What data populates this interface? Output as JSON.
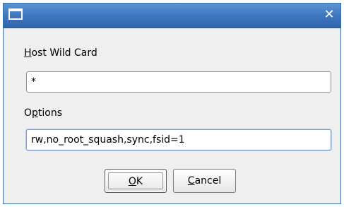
{
  "window": {
    "title": "",
    "close_glyph": "✕",
    "icon": "window-icon"
  },
  "form": {
    "host_label_mnemonic": "H",
    "host_label_rest": "ost Wild Card",
    "host_value": "*",
    "options_label_pre": "O",
    "options_label_mnemonic": "p",
    "options_label_rest": "tions",
    "options_value": "rw,no_root_squash,sync,fsid=1"
  },
  "buttons": {
    "ok_mnemonic": "O",
    "ok_rest": "K",
    "cancel_mnemonic": "C",
    "cancel_rest": "ancel"
  },
  "colors": {
    "titlebar": "#3f78c0",
    "focus_border": "#7a9ccf"
  }
}
